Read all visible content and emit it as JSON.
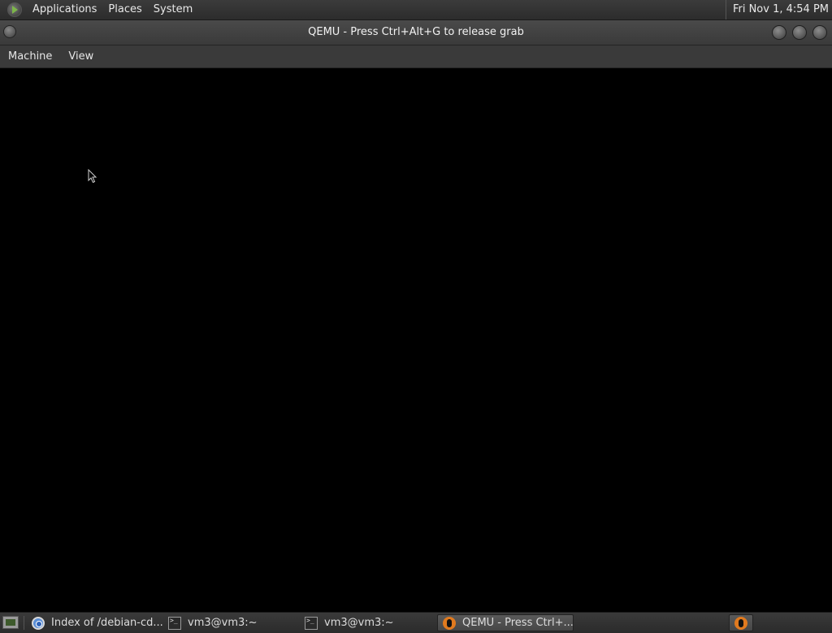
{
  "top_panel": {
    "menus": [
      "Applications",
      "Places",
      "System"
    ],
    "clock": "Fri Nov  1,  4:54 PM"
  },
  "window": {
    "title": "QEMU - Press Ctrl+Alt+G to release grab"
  },
  "menubar": {
    "items": [
      "Machine",
      "View"
    ]
  },
  "taskbar": {
    "tasks": [
      {
        "label": "Index of /debian-cd...",
        "icon": "chrome-icon"
      },
      {
        "label": "vm3@vm3:~",
        "icon": "terminal-icon"
      },
      {
        "label": "vm3@vm3:~",
        "icon": "terminal-icon"
      },
      {
        "label": "QEMU - Press Ctrl+...",
        "icon": "qemu-icon",
        "active": true
      }
    ]
  },
  "colors": {
    "panel": "#333333",
    "vm_background": "#000000"
  }
}
